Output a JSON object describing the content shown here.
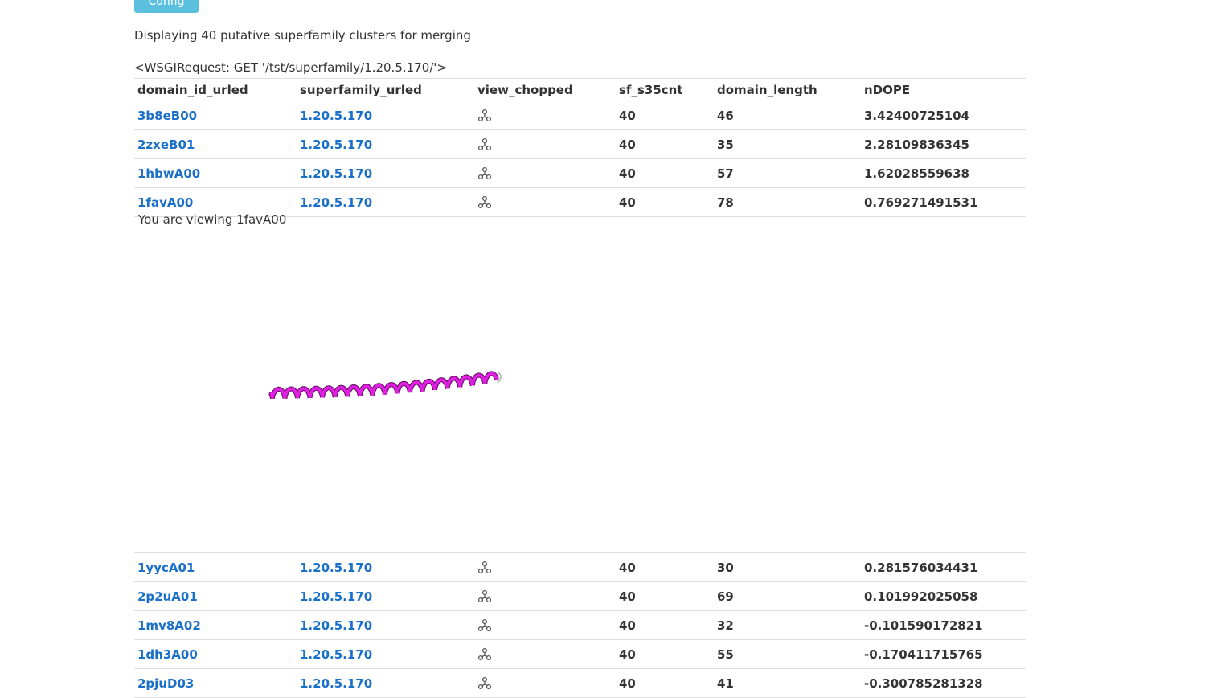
{
  "config_button": "Config",
  "summary": "Displaying 40 putative superfamily clusters for merging",
  "request": "<WSGIRequest: GET '/tst/superfamily/1.20.5.170/'>",
  "columns": [
    "domain_id_urled",
    "superfamily_urled",
    "view_chopped",
    "sf_s35cnt",
    "domain_length",
    "nDOPE"
  ],
  "rows_top": [
    {
      "domain_id": "3b8eB00",
      "superfamily": "1.20.5.170",
      "view_icon": "molecule-icon",
      "sf_s35cnt": "40",
      "domain_length": "46",
      "ndope": "3.42400725104"
    },
    {
      "domain_id": "2zxeB01",
      "superfamily": "1.20.5.170",
      "view_icon": "molecule-icon",
      "sf_s35cnt": "40",
      "domain_length": "35",
      "ndope": "2.28109836345"
    },
    {
      "domain_id": "1hbwA00",
      "superfamily": "1.20.5.170",
      "view_icon": "molecule-icon",
      "sf_s35cnt": "40",
      "domain_length": "57",
      "ndope": "1.62028559638"
    },
    {
      "domain_id": "1favA00",
      "superfamily": "1.20.5.170",
      "view_icon": "molecule-icon",
      "sf_s35cnt": "40",
      "domain_length": "78",
      "ndope": "0.769271491531"
    }
  ],
  "viewing_text": "You are viewing 1favA00",
  "viewer": {
    "structure_color": "#e020e0",
    "style": "cartoon helix"
  },
  "rows_bottom": [
    {
      "domain_id": "1yycA01",
      "superfamily": "1.20.5.170",
      "view_icon": "molecule-icon",
      "sf_s35cnt": "40",
      "domain_length": "30",
      "ndope": "0.281576034431"
    },
    {
      "domain_id": "2p2uA01",
      "superfamily": "1.20.5.170",
      "view_icon": "molecule-icon",
      "sf_s35cnt": "40",
      "domain_length": "69",
      "ndope": "0.101992025058"
    },
    {
      "domain_id": "1mv8A02",
      "superfamily": "1.20.5.170",
      "view_icon": "molecule-icon",
      "sf_s35cnt": "40",
      "domain_length": "32",
      "ndope": "-0.101590172821"
    },
    {
      "domain_id": "1dh3A00",
      "superfamily": "1.20.5.170",
      "view_icon": "molecule-icon",
      "sf_s35cnt": "40",
      "domain_length": "55",
      "ndope": "-0.170411715765"
    },
    {
      "domain_id": "2pjuD03",
      "superfamily": "1.20.5.170",
      "view_icon": "molecule-icon",
      "sf_s35cnt": "40",
      "domain_length": "41",
      "ndope": "-0.300785281328"
    }
  ],
  "colors": {
    "link": "#1a6fc9",
    "button": "#5bc0de",
    "text": "#333333"
  }
}
